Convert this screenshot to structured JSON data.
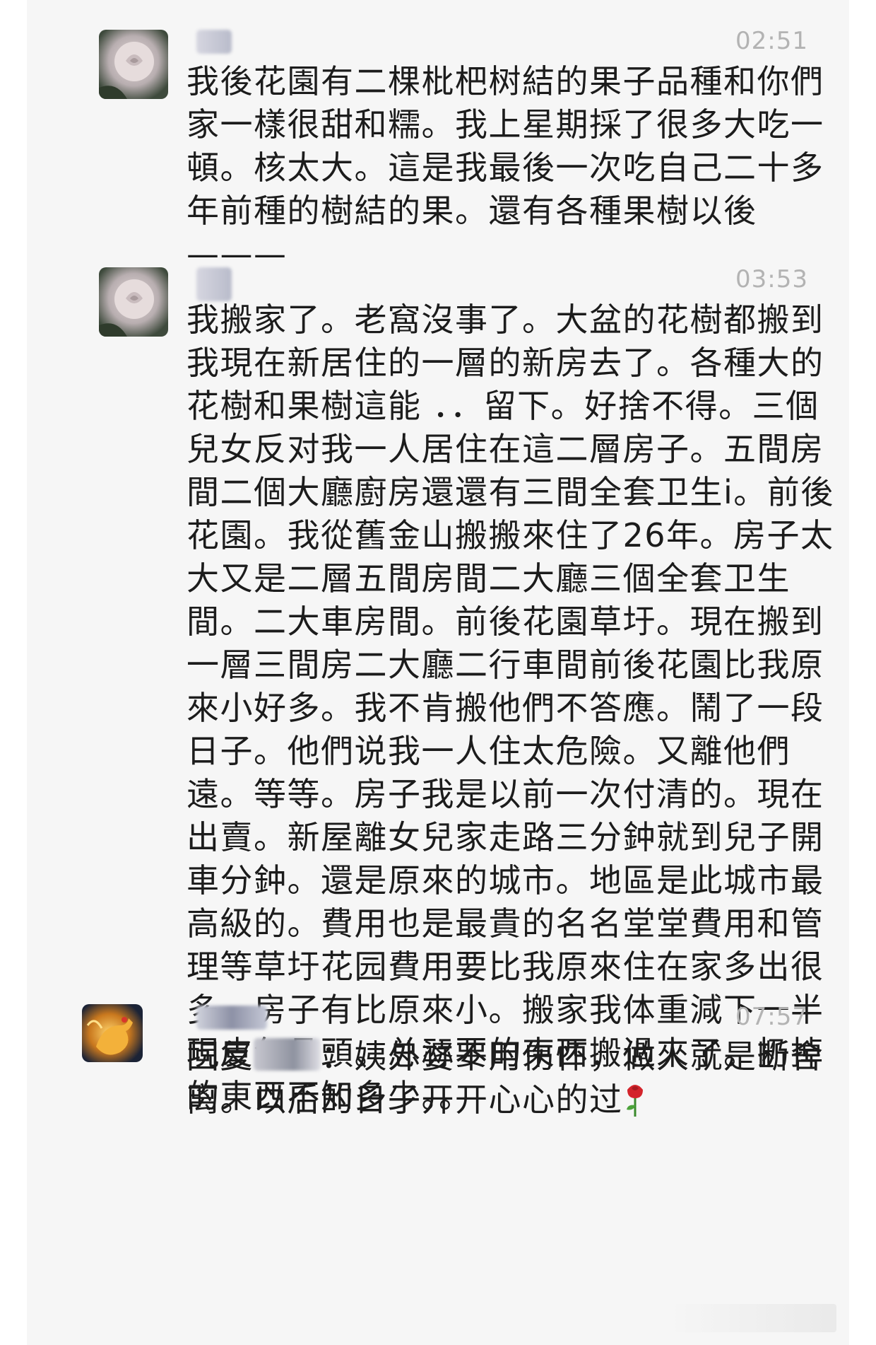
{
  "messages": [
    {
      "time": "02:51",
      "avatar": "white-rose-avatar",
      "text": "我後花園有二棵枇杷树結的果子品種和你們家一樣很甜和糯。我上星期採了很多大吃一頓。核太大。這是我最後一次吃自己二十多年前種的樹結的果。還有各種果樹以後———"
    },
    {
      "time": "03:53",
      "avatar": "white-rose-avatar",
      "text": "我搬家了。老窩沒事了。大盆的花樹都搬到我現在新居住的一層的新房去了。各種大的花樹和果樹這能 ．．留下。好捨不得。三個兒女反对我一人居住在這二層房子。五間房間二個大廳廚房還還有三間全套卫生i。前後花園。我從舊金山搬搬來住了26年。房子太大又是二層五間房間二大廳三個全套卫生間。二大車房間。前後花園草圩。現在搬到一層三間房二大廳二行車間前後花園比我原來小好多。我不肯搬他們不答應。鬧了一段日子。他們说我一人住太危險。又離他們遠。等等。房子我是以前一次付清的。現在出賣。新屋離女兒家走路三分鈡就到兒子開車分鈡。還是原來的城市。地區是此城市最高級的。費用也是最貴的名名堂堂費用和管理等草圩花园費用要比我原來住在家多出很多。房子有比原來小。搬家我体重減下一半現皮包骨頭。总祘要的東西搬過來了。扔掉的東西不知多少。。"
    },
    {
      "time": "07:57",
      "avatar": "golden-rooster-avatar",
      "text_before": "回复",
      "text_after": "：姨外婆不用伤怀，做人就是断舍离。以后的日子开开心心的过",
      "emoji": "rose-emoji"
    }
  ],
  "colors": {
    "background": "#f6f6f6",
    "text": "#1c1c1c",
    "timestamp": "#b3b3b3"
  }
}
